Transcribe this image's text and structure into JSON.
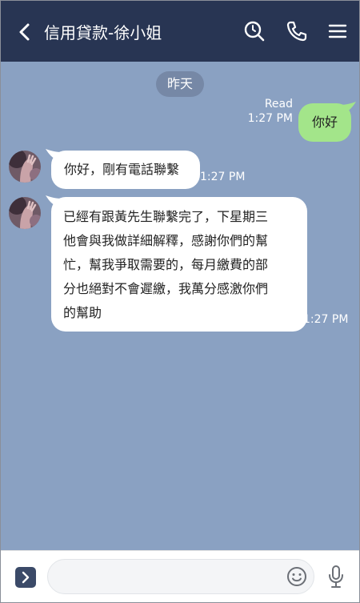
{
  "header": {
    "title": "信用貸款-徐小姐",
    "back_icon": "chevron-left-icon",
    "search_icon": "search-icon",
    "call_icon": "phone-icon",
    "menu_icon": "menu-icon",
    "background_color": "#283553"
  },
  "chat": {
    "background_color": "#8aa1c2",
    "date_separator": "昨天",
    "messages": [
      {
        "direction": "sent",
        "text": "你好",
        "read_label": "Read",
        "time": "1:27 PM",
        "bubble_color": "#a3e58a"
      },
      {
        "direction": "received",
        "text": "你好，剛有電話聯繫",
        "time": "1:27 PM",
        "bubble_color": "#ffffff"
      },
      {
        "direction": "received",
        "lines": [
          "已經有跟黃先生聯繫完了，下星期三",
          "他會與我做詳細解釋，感謝你們的幫",
          "忙，幫我爭取需要的，每月繳費的部",
          "分也絕對不會遲繳，我萬分感激你們",
          "的幫助"
        ],
        "time": "1:27 PM",
        "bubble_color": "#ffffff"
      }
    ]
  },
  "bottom_bar": {
    "expand_icon": "chevron-right-icon",
    "input_value": "",
    "emoji_icon": "emoji-icon",
    "mic_icon": "microphone-icon"
  }
}
